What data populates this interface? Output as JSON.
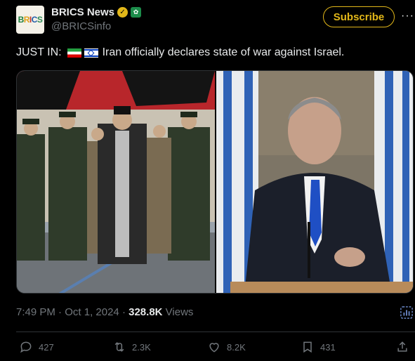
{
  "author": {
    "display_name": "BRICS News",
    "handle": "@BRICSinfo",
    "avatar_text": "BRICS",
    "verified_icon": "gold-check-icon",
    "affiliate_icon": "affiliate-badge-icon"
  },
  "subscribe_label": "Subscribe",
  "more_label": "···",
  "tweet": {
    "prefix": "JUST IN:",
    "body": "Iran officially declares state of war against Israel."
  },
  "meta": {
    "time": "7:49 PM",
    "date": "Oct 1, 2024",
    "views": "328.8K",
    "views_label": "Views"
  },
  "actions": {
    "replies": "427",
    "reposts": "2.3K",
    "likes": "8.2K",
    "bookmarks": "431"
  },
  "colors": {
    "gold": "#e2b719",
    "muted": "#71767b",
    "text": "#e7e9ea"
  }
}
